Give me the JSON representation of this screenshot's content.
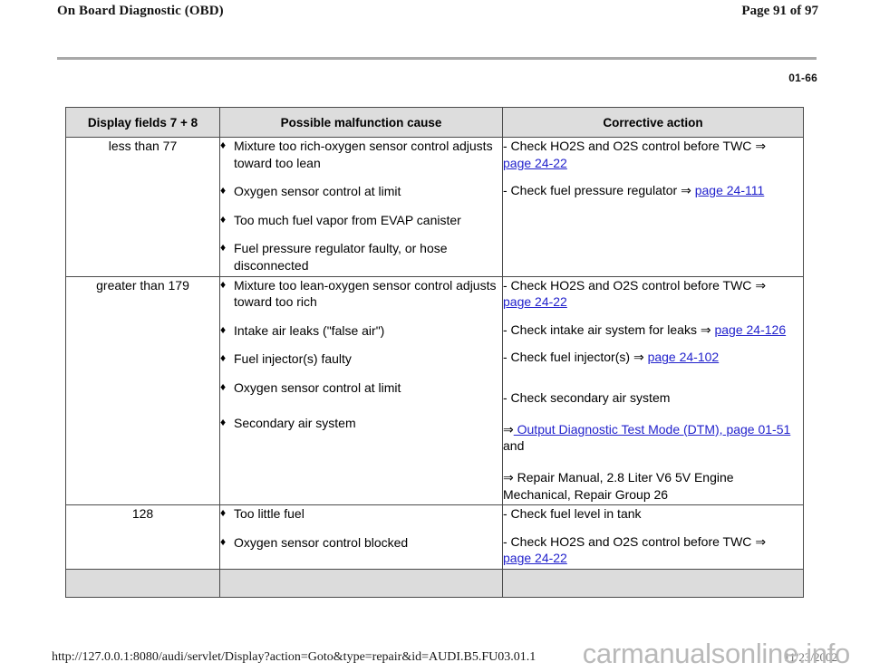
{
  "header": {
    "title": "On Board Diagnostic (OBD)",
    "page_label": "Page 91 of 97",
    "section_code": "01-66"
  },
  "table": {
    "columns": [
      "Display fields 7 + 8",
      "Possible malfunction cause",
      "Corrective action"
    ],
    "rows": [
      {
        "display_field": "less than 77",
        "causes": [
          "Mixture too rich-oxygen sensor control adjusts toward too lean",
          "Oxygen sensor control at limit",
          "Too much fuel vapor from EVAP canister",
          "Fuel pressure regulator faulty, or hose disconnected"
        ],
        "actions": [
          {
            "pre": "- Check HO2S and O2S control before TWC ",
            "arrow": "⇒",
            "link": "page 24-22",
            "post": ""
          },
          {
            "pre": "- Check fuel pressure regulator ",
            "arrow": "⇒",
            "link": "page 24-111",
            "post": ""
          }
        ]
      },
      {
        "display_field": "greater than 179",
        "causes": [
          "Mixture too lean-oxygen sensor control adjusts toward too rich",
          "Intake air leaks (\"false air\")",
          "Fuel injector(s) faulty",
          "Oxygen sensor control at limit",
          "Secondary air system"
        ],
        "actions": [
          {
            "pre": "- Check HO2S and O2S control before TWC ",
            "arrow": "⇒",
            "link": "page 24-22",
            "post": ""
          },
          {
            "pre": "- Check intake air system for leaks ",
            "arrow": "⇒",
            "link": "page 24-126",
            "post": ""
          },
          {
            "pre": "- Check fuel injector(s) ",
            "arrow": "⇒",
            "link": "page 24-102",
            "post": ""
          },
          {
            "pre": " - Check secondary air system",
            "arrow": "",
            "link": "",
            "post": ""
          },
          {
            "pre": "",
            "arrow": "⇒",
            "link": " Output Diagnostic Test Mode (DTM), page 01-51",
            "post": " and"
          },
          {
            "pre": "",
            "arrow": "⇒",
            "link": "",
            "post": " Repair Manual, 2.8 Liter V6 5V Engine Mechanical, Repair Group 26"
          }
        ]
      },
      {
        "display_field": "128",
        "causes": [
          "Too little fuel",
          "Oxygen sensor control blocked"
        ],
        "actions": [
          {
            "pre": "- Check fuel level in tank",
            "arrow": "",
            "link": "",
            "post": ""
          },
          {
            "pre": "- Check HO2S and O2S control before TWC ",
            "arrow": "⇒",
            "link": "page 24-22",
            "post": ""
          }
        ]
      }
    ],
    "bullet_glyph": "♦"
  },
  "footer": {
    "url": "http://127.0.0.1:8080/audi/servlet/Display?action=Goto&type=repair&id=AUDI.B5.FU03.01.1",
    "date": "11/23/2002",
    "watermark": "carmanualsonline.info"
  },
  "colors": {
    "link": "#2222cc",
    "header_fill": "#dddddd",
    "footer_fill": "#dcdcdc",
    "rule": "#a8a8a8"
  }
}
